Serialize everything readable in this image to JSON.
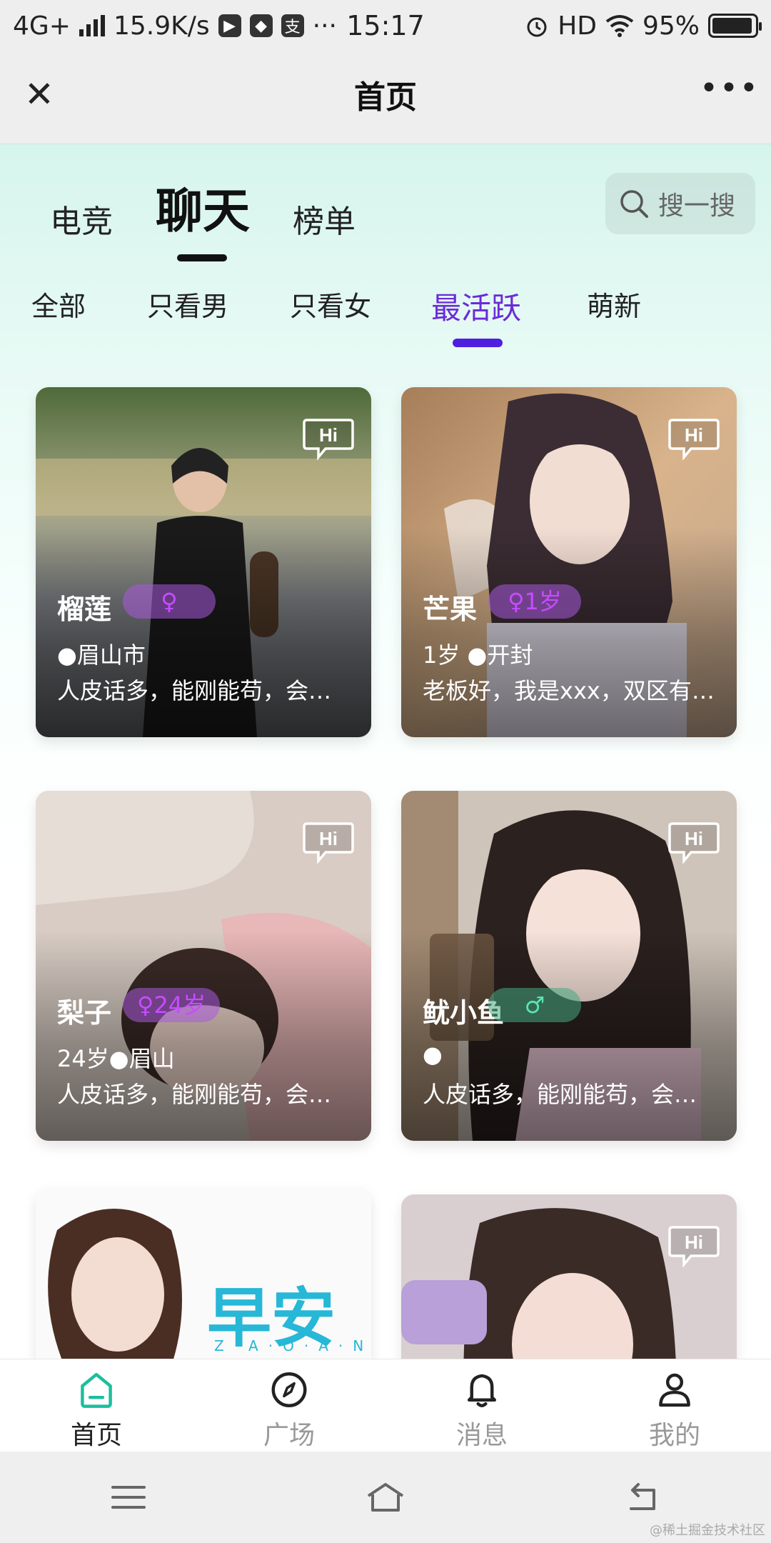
{
  "status_bar": {
    "network": "4G+",
    "speed": "15.9K/s",
    "app_icon_labels": [
      "▶",
      "◆",
      "支"
    ],
    "more": "···",
    "time": "15:17",
    "hd": "HD",
    "battery": "95%",
    "battery_level": 0.95
  },
  "title_bar": {
    "title": "首页",
    "close_glyph": "✕",
    "more_glyph": "•••"
  },
  "top_tabs": [
    {
      "label": "电竞",
      "active": false
    },
    {
      "label": "聊天",
      "active": true
    },
    {
      "label": "榜单",
      "active": false
    }
  ],
  "search": {
    "placeholder": "搜一搜"
  },
  "filter_tabs": [
    {
      "label": "全部",
      "active": false
    },
    {
      "label": "只看男",
      "active": false
    },
    {
      "label": "只看女",
      "active": false
    },
    {
      "label": "最活跃",
      "active": true
    },
    {
      "label": "萌新",
      "active": false
    }
  ],
  "cards": [
    {
      "name": "榴莲",
      "tag": "♀",
      "gender": "female",
      "meta": "●眉山市",
      "desc": "人皮话多，能刚能苟，会…",
      "hi": "Hi"
    },
    {
      "name": "芒果",
      "tag": "♀1岁",
      "gender": "female",
      "meta": "1岁 ●开封",
      "desc": "老板好，我是xxx，双区有…",
      "hi": "Hi"
    },
    {
      "name": "梨子",
      "tag": "♀24岁",
      "gender": "female",
      "meta": "24岁●眉山",
      "desc": "人皮话多，能刚能苟，会…",
      "hi": "Hi"
    },
    {
      "name": "鱿小鱼",
      "tag": "♂",
      "gender": "male",
      "meta": "●",
      "desc": "人皮话多，能刚能苟，会…",
      "hi": "Hi"
    },
    {
      "name": "",
      "tag": "",
      "gender": "",
      "meta": "",
      "desc": "",
      "hi": "",
      "overlay_text": "早安",
      "overlay_sub": "Z·A·O·A·N"
    },
    {
      "name": "",
      "tag": "",
      "gender": "",
      "meta": "",
      "desc": "",
      "hi": "Hi"
    }
  ],
  "bottom_nav": [
    {
      "label": "首页",
      "icon": "home-icon",
      "active": true
    },
    {
      "label": "广场",
      "icon": "compass-icon",
      "active": false
    },
    {
      "label": "消息",
      "icon": "bell-icon",
      "active": false
    },
    {
      "label": "我的",
      "icon": "user-icon",
      "active": false
    }
  ],
  "watermark": "@稀土掘金技术社区",
  "colors": {
    "accent_purple": "#6a2bd9",
    "nav_active": "#1bbf9d",
    "gradient_top": "#d6f5ec"
  }
}
